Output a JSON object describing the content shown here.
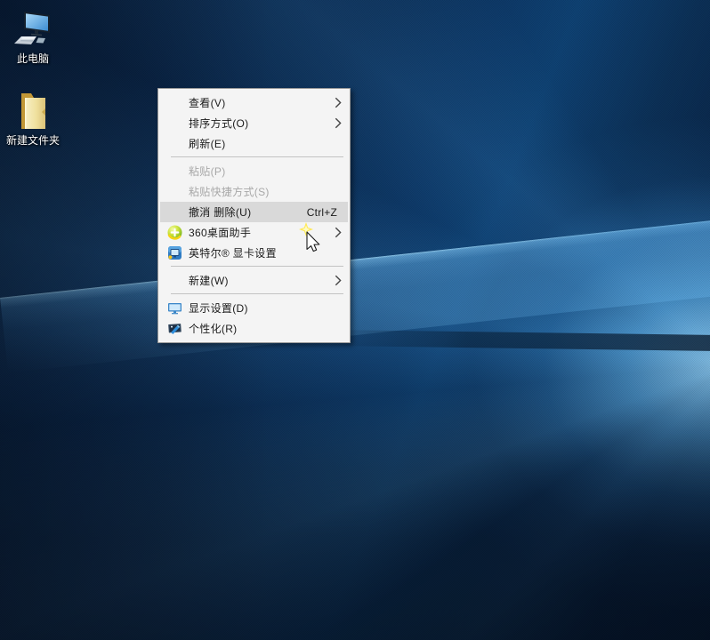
{
  "desktop": {
    "icons": [
      {
        "id": "this-pc",
        "label": "此电脑"
      },
      {
        "id": "new-folder",
        "label": "新建文件夹"
      }
    ]
  },
  "context_menu": {
    "background_color": "#f4f4f4",
    "highlight_color": "#d9d9d9",
    "disabled_text_color": "#a8a8a8",
    "items": [
      {
        "type": "item",
        "id": "view",
        "label": "查看(V)",
        "submenu": true
      },
      {
        "type": "item",
        "id": "sort-by",
        "label": "排序方式(O)",
        "submenu": true
      },
      {
        "type": "item",
        "id": "refresh",
        "label": "刷新(E)"
      },
      {
        "type": "separator"
      },
      {
        "type": "item",
        "id": "paste",
        "label": "粘贴(P)",
        "disabled": true
      },
      {
        "type": "item",
        "id": "paste-shortcut",
        "label": "粘贴快捷方式(S)",
        "disabled": true
      },
      {
        "type": "item",
        "id": "undo-delete",
        "label": "撤消 删除(U)",
        "shortcut": "Ctrl+Z",
        "highlighted": true
      },
      {
        "type": "item",
        "id": "360-desktop-assistant",
        "label": "360桌面助手",
        "icon": "icon-360",
        "submenu": true
      },
      {
        "type": "item",
        "id": "intel-graphics-settings",
        "label": "英特尔® 显卡设置",
        "icon": "icon-intel"
      },
      {
        "type": "separator"
      },
      {
        "type": "item",
        "id": "new",
        "label": "新建(W)",
        "submenu": true
      },
      {
        "type": "separator"
      },
      {
        "type": "item",
        "id": "display-settings",
        "label": "显示设置(D)",
        "icon": "icon-display"
      },
      {
        "type": "item",
        "id": "personalize",
        "label": "个性化(R)",
        "icon": "icon-personalize"
      }
    ]
  },
  "wallpaper": {
    "base_color": "#0c2e55",
    "glow_color": "#5fb3ef"
  }
}
